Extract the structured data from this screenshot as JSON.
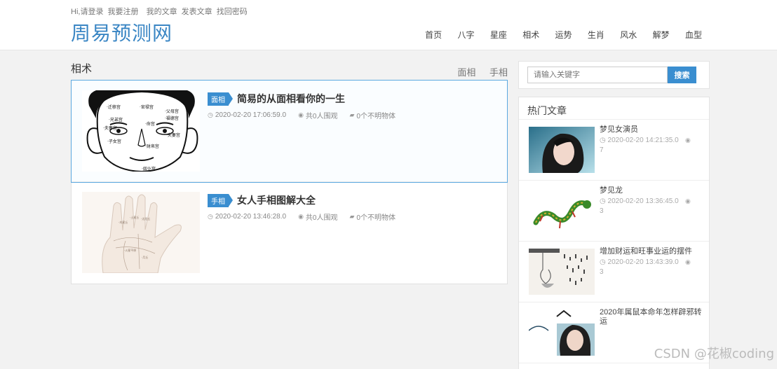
{
  "header": {
    "top_links": [
      "Hi,请登录",
      "我要注册",
      "我的文章",
      "发表文章",
      "找回密码"
    ],
    "logo": "周易预测网",
    "nav": [
      "首页",
      "八字",
      "星座",
      "相术",
      "运势",
      "生肖",
      "风水",
      "解梦",
      "血型"
    ]
  },
  "main": {
    "category_title": "相术",
    "tabs": [
      "面相",
      "手相"
    ],
    "articles": [
      {
        "tag": "面相",
        "title": "简易的从面相看你的一生",
        "date": "2020-02-20 17:06:59.0",
        "views": "共0人围观",
        "comments": "0个不明物体"
      },
      {
        "tag": "手相",
        "title": "女人手相图解大全",
        "date": "2020-02-20 13:46:28.0",
        "views": "共0人围观",
        "comments": "0个不明物体"
      }
    ]
  },
  "sidebar": {
    "search": {
      "placeholder": "请输入关键字",
      "button": "搜索"
    },
    "hot_title": "热门文章",
    "hot_items": [
      {
        "name": "梦见女演员",
        "date": "2020-02-20 14:21:35.0",
        "views": "7"
      },
      {
        "name": "梦见龙",
        "date": "2020-02-20 13:36:45.0",
        "views": "3"
      },
      {
        "name": "增加财运和旺事业运的摆件",
        "date": "2020-02-20 13:43:39.0",
        "views": "3"
      },
      {
        "name": "2020年属鼠本命年怎样辟邪转运",
        "date": "",
        "views": ""
      }
    ]
  },
  "watermark": "CSDN @花椒coding",
  "colors": {
    "accent": "#3a8ed0",
    "logo": "#3a86c4"
  },
  "icons": {
    "date": "clock-icon",
    "views": "eye-icon",
    "comments": "comment-icon"
  }
}
